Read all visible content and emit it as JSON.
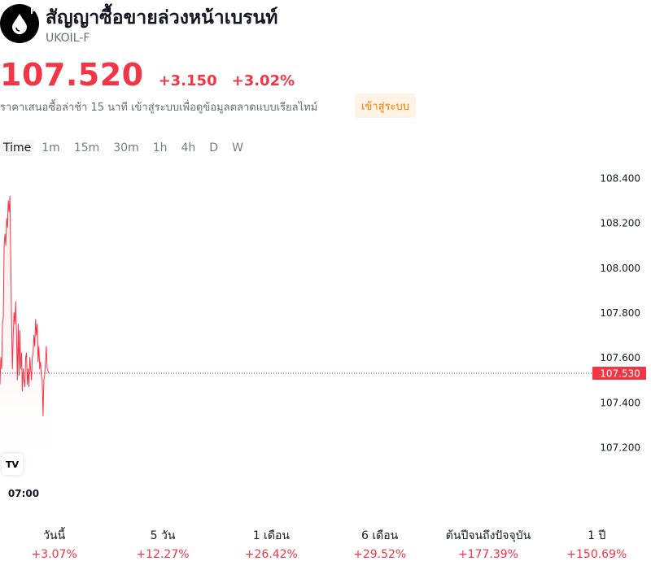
{
  "header": {
    "logo_icon": "oil-drop-icon",
    "logo_badge": "F",
    "title": "สัญญาซื้อขายล่วงหน้าเบรนท์",
    "ticker": "UKOIL-F"
  },
  "quote": {
    "price": "107.520",
    "change": "+3.150",
    "change_percent": "+3.02%",
    "delay_note": "ราคาเสนอซื้อล่าช้า 15 นาที เข้าสู่ระบบเพื่อดูข้อมูลตลาดแบบเรียลไทม์",
    "login_label": "เข้าสู่ระบบ"
  },
  "timeframes": [
    "Time",
    "1m",
    "15m",
    "30m",
    "1h",
    "4h",
    "D",
    "W"
  ],
  "colors": {
    "down_red": "#f23645",
    "login_text": "#f57c00",
    "login_bg": "#fff3e6"
  },
  "chart_data": {
    "type": "line",
    "ylim": [
      107.1,
      108.45
    ],
    "y_ticks": [
      "108.400",
      "108.200",
      "108.000",
      "107.800",
      "107.600",
      "107.400",
      "107.200"
    ],
    "x_ticks": [
      "07:00"
    ],
    "last_price_label": "107.530",
    "last_price": 107.53,
    "grid": false,
    "series": [
      {
        "values": [
          107.48,
          107.6,
          107.55,
          107.75,
          107.78,
          108.1,
          108.15,
          108.1,
          108.22,
          108.18,
          108.3,
          108.25,
          108.32,
          108.05,
          107.75,
          107.55,
          107.7,
          107.8,
          107.75,
          107.85,
          107.7,
          107.5,
          107.75,
          107.52,
          107.72,
          107.55,
          107.62,
          107.45,
          107.55,
          107.5,
          107.47,
          107.6,
          107.62,
          107.48,
          107.55,
          107.47,
          107.6,
          107.55,
          107.5,
          107.6,
          107.62,
          107.7,
          107.65,
          107.77,
          107.7,
          107.75,
          107.58,
          107.65,
          107.55,
          107.58,
          107.52,
          107.5,
          107.34,
          107.5,
          107.52,
          107.58,
          107.65,
          107.55,
          107.54,
          107.53
        ]
      }
    ]
  },
  "performance": [
    {
      "label": "วันนี้",
      "value": "+3.07%"
    },
    {
      "label": "5 วัน",
      "value": "+12.27%"
    },
    {
      "label": "1 เดือน",
      "value": "+26.42%"
    },
    {
      "label": "6 เดือน",
      "value": "+29.52%"
    },
    {
      "label": "ต้นปีจนถึงปัจจุบัน",
      "value": "+177.39%"
    },
    {
      "label": "1 ปี",
      "value": "+150.69%"
    }
  ]
}
